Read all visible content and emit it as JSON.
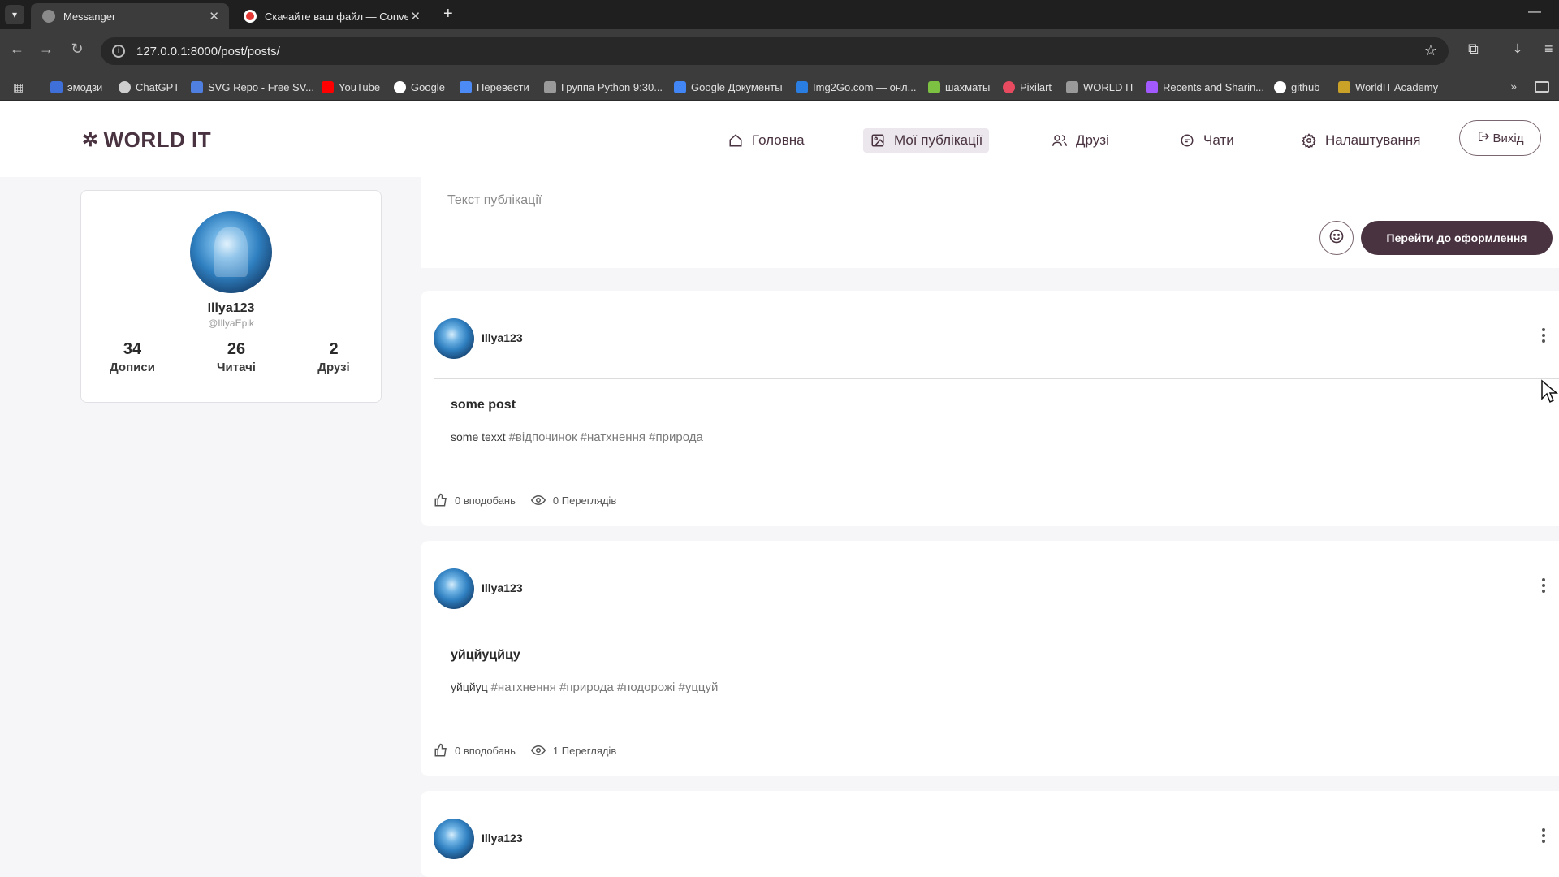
{
  "browser": {
    "tabs": [
      {
        "title": "Messanger",
        "active": true
      },
      {
        "title": "Скачайте ваш файл — Conver",
        "active": false
      }
    ],
    "url": "127.0.0.1:8000/post/posts/",
    "bookmarks": [
      {
        "label": "эмодзи",
        "color": "#3f6fd8"
      },
      {
        "label": "ChatGPT",
        "color": "#cfcfcf"
      },
      {
        "label": "SVG Repo - Free SV...",
        "color": "#4f7fe0"
      },
      {
        "label": "YouTube",
        "color": "#ff0000"
      },
      {
        "label": "Google",
        "color": "#ffffff"
      },
      {
        "label": "Перевести",
        "color": "#4c8bf5"
      },
      {
        "label": "Группа Python 9:30...",
        "color": "#9a9a9a"
      },
      {
        "label": "Google Документы",
        "color": "#4285f4"
      },
      {
        "label": "Img2Go.com — онл...",
        "color": "#2a7de1"
      },
      {
        "label": "шахматы",
        "color": "#7cc142"
      },
      {
        "label": "Pixilart",
        "color": "#e84a5f"
      },
      {
        "label": "WORLD IT",
        "color": "#9a9a9a"
      },
      {
        "label": "Recents and Sharin...",
        "color": "#a259ff"
      },
      {
        "label": "github",
        "color": "#ffffff"
      },
      {
        "label": "WorldIT Academy",
        "color": "#c9a227"
      }
    ]
  },
  "header": {
    "logo": "WORLD IT",
    "nav": [
      {
        "label": "Головна",
        "icon": "home-icon"
      },
      {
        "label": "Мої публікації",
        "icon": "image-icon",
        "active": true
      },
      {
        "label": "Друзі",
        "icon": "users-icon"
      },
      {
        "label": "Чати",
        "icon": "chat-icon"
      },
      {
        "label": "Налаштування",
        "icon": "gear-icon"
      }
    ],
    "logout": "Вихід"
  },
  "profile": {
    "name": "Illya123",
    "handle": "@IllyaEpik",
    "stats": [
      {
        "value": "34",
        "label": "Дописи"
      },
      {
        "value": "26",
        "label": "Читачі"
      },
      {
        "value": "2",
        "label": "Друзі"
      }
    ]
  },
  "composer": {
    "placeholder": "Текст публікації",
    "submit_label": "Перейти до оформлення"
  },
  "posts": [
    {
      "author": "Illya123",
      "title": "some post",
      "text": "some texxt",
      "tags": "#відпочинок #натхнення #природа",
      "likes": "0 вподобань",
      "views": "0 Переглядів"
    },
    {
      "author": "Illya123",
      "title": "уйцйуцйцу",
      "text": "уйцйуц",
      "tags": "#натхнення #природа #подорожі #уццуй",
      "likes": "0 вподобань",
      "views": "1 Переглядів"
    },
    {
      "author": "Illya123"
    }
  ],
  "colors": {
    "brand": "#4a3340",
    "page_bg": "#f6f6f8",
    "chrome_bg": "#3c3c3c"
  }
}
